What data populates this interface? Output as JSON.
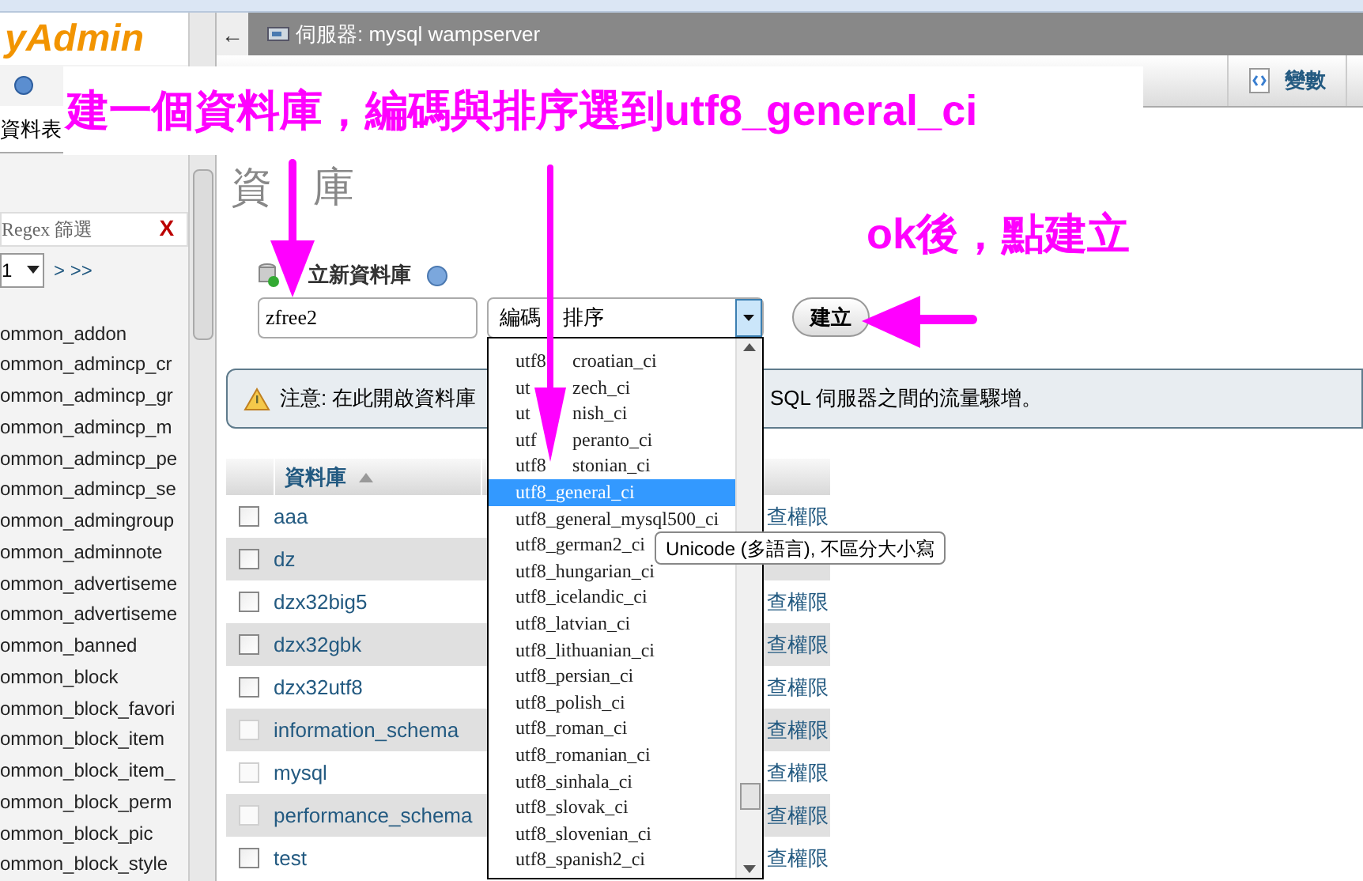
{
  "sidebar": {
    "logo": "yAdmin",
    "tab_label": "資料表",
    "filter": {
      "placeholder": "Regex 篩選",
      "clear": "X"
    },
    "pager": {
      "value": "1",
      "nav": "> >>"
    },
    "tables": [
      "ommon_addon",
      "ommon_admincp_cr",
      "ommon_admincp_gr",
      "ommon_admincp_m",
      "ommon_admincp_pe",
      "ommon_admincp_se",
      "ommon_admingroup",
      "ommon_adminnote",
      "ommon_advertiseme",
      "ommon_advertiseme",
      "ommon_banned",
      "ommon_block",
      "ommon_block_favori",
      "ommon_block_item",
      "ommon_block_item_",
      "ommon_block_perm",
      "ommon_block_pic",
      "ommon_block_style"
    ]
  },
  "topbar": {
    "back": "←",
    "server": "伺服器: mysql wampserver"
  },
  "tabs": [
    {
      "label": "變數",
      "selected": false
    }
  ],
  "heading": [
    "資",
    "庫"
  ],
  "create": {
    "title": "立新資料庫",
    "name_value": "zfree2",
    "collation": [
      "編碼",
      "排序"
    ],
    "button": "建立"
  },
  "notice": {
    "left": "注意: 在此開啟資料庫",
    "right": "SQL 伺服器之間的流量驟增。"
  },
  "table": {
    "columns": [
      "資料庫"
    ],
    "rows": [
      {
        "name": "aaa",
        "disabled": false,
        "action": "查權限"
      },
      {
        "name": "dz",
        "disabled": false
      },
      {
        "name": "dzx32big5",
        "disabled": false,
        "action": "查權限"
      },
      {
        "name": "dzx32gbk",
        "disabled": false,
        "action": "查權限"
      },
      {
        "name": "dzx32utf8",
        "disabled": false,
        "action": "查權限"
      },
      {
        "name": "information_schema",
        "disabled": true,
        "action": "查權限"
      },
      {
        "name": "mysql",
        "disabled": true,
        "action": "查權限"
      },
      {
        "name": "performance_schema",
        "disabled": true,
        "action": "查權限"
      },
      {
        "name": "test",
        "disabled": false,
        "action": "查權限"
      }
    ]
  },
  "dropdown": {
    "options": [
      {
        "parts": [
          "utf8",
          "croatian_ci"
        ],
        "selected": false
      },
      {
        "parts": [
          "ut",
          "zech_ci"
        ],
        "selected": false
      },
      {
        "parts": [
          "ut",
          "nish_ci"
        ],
        "selected": false
      },
      {
        "parts": [
          "utf",
          "peranto_ci"
        ],
        "selected": false
      },
      {
        "parts": [
          "utf8",
          "stonian_ci"
        ],
        "selected": false
      },
      {
        "parts": [
          "utf8_general_ci"
        ],
        "selected": true
      },
      {
        "parts": [
          "utf8_general_mysql500_ci"
        ],
        "selected": false
      },
      {
        "parts": [
          "utf8_german2_ci"
        ],
        "selected": false
      },
      {
        "parts": [
          "utf8_hungarian_ci"
        ],
        "selected": false
      },
      {
        "parts": [
          "utf8_icelandic_ci"
        ],
        "selected": false
      },
      {
        "parts": [
          "utf8_latvian_ci"
        ],
        "selected": false
      },
      {
        "parts": [
          "utf8_lithuanian_ci"
        ],
        "selected": false
      },
      {
        "parts": [
          "utf8_persian_ci"
        ],
        "selected": false
      },
      {
        "parts": [
          "utf8_polish_ci"
        ],
        "selected": false
      },
      {
        "parts": [
          "utf8_roman_ci"
        ],
        "selected": false
      },
      {
        "parts": [
          "utf8_romanian_ci"
        ],
        "selected": false
      },
      {
        "parts": [
          "utf8_sinhala_ci"
        ],
        "selected": false
      },
      {
        "parts": [
          "utf8_slovak_ci"
        ],
        "selected": false
      },
      {
        "parts": [
          "utf8_slovenian_ci"
        ],
        "selected": false
      },
      {
        "parts": [
          "utf8_spanish2_ci"
        ],
        "selected": false
      }
    ]
  },
  "tooltip": "Unicode (多語言), 不區分大小寫",
  "annotations": [
    {
      "text": "建一個資料庫，編碼與排序選到utf8_general_ci"
    },
    {
      "text": "ok後，點建立"
    }
  ]
}
